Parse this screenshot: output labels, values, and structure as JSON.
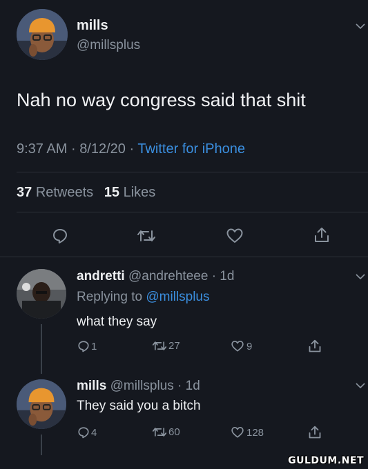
{
  "main_tweet": {
    "display_name": "mills",
    "handle": "@millsplus",
    "text": "Nah no way congress said that shit",
    "time": "9:37 AM",
    "sep1": "·",
    "date": "8/12/20",
    "sep2": "·",
    "source": "Twitter for iPhone",
    "retweets_count": "37",
    "retweets_label": "Retweets",
    "likes_count": "15",
    "likes_label": "Likes"
  },
  "reply1": {
    "display_name": "andretti",
    "handle": "@andrehteee",
    "sep": "·",
    "age": "1d",
    "replying_label": "Replying to",
    "replying_to": "@millsplus",
    "text": "what they say",
    "reply_count": "1",
    "retweet_count": "27",
    "like_count": "9"
  },
  "reply2": {
    "display_name": "mills",
    "handle": "@millsplus",
    "sep": "·",
    "age": "1d",
    "text": "They said you a bitch",
    "reply_count": "4",
    "retweet_count": "60",
    "like_count": "128"
  },
  "watermark": "GULDUM.NET",
  "colors": {
    "background": "#15181f",
    "link": "#3b8fe0",
    "muted": "#8a939e"
  }
}
